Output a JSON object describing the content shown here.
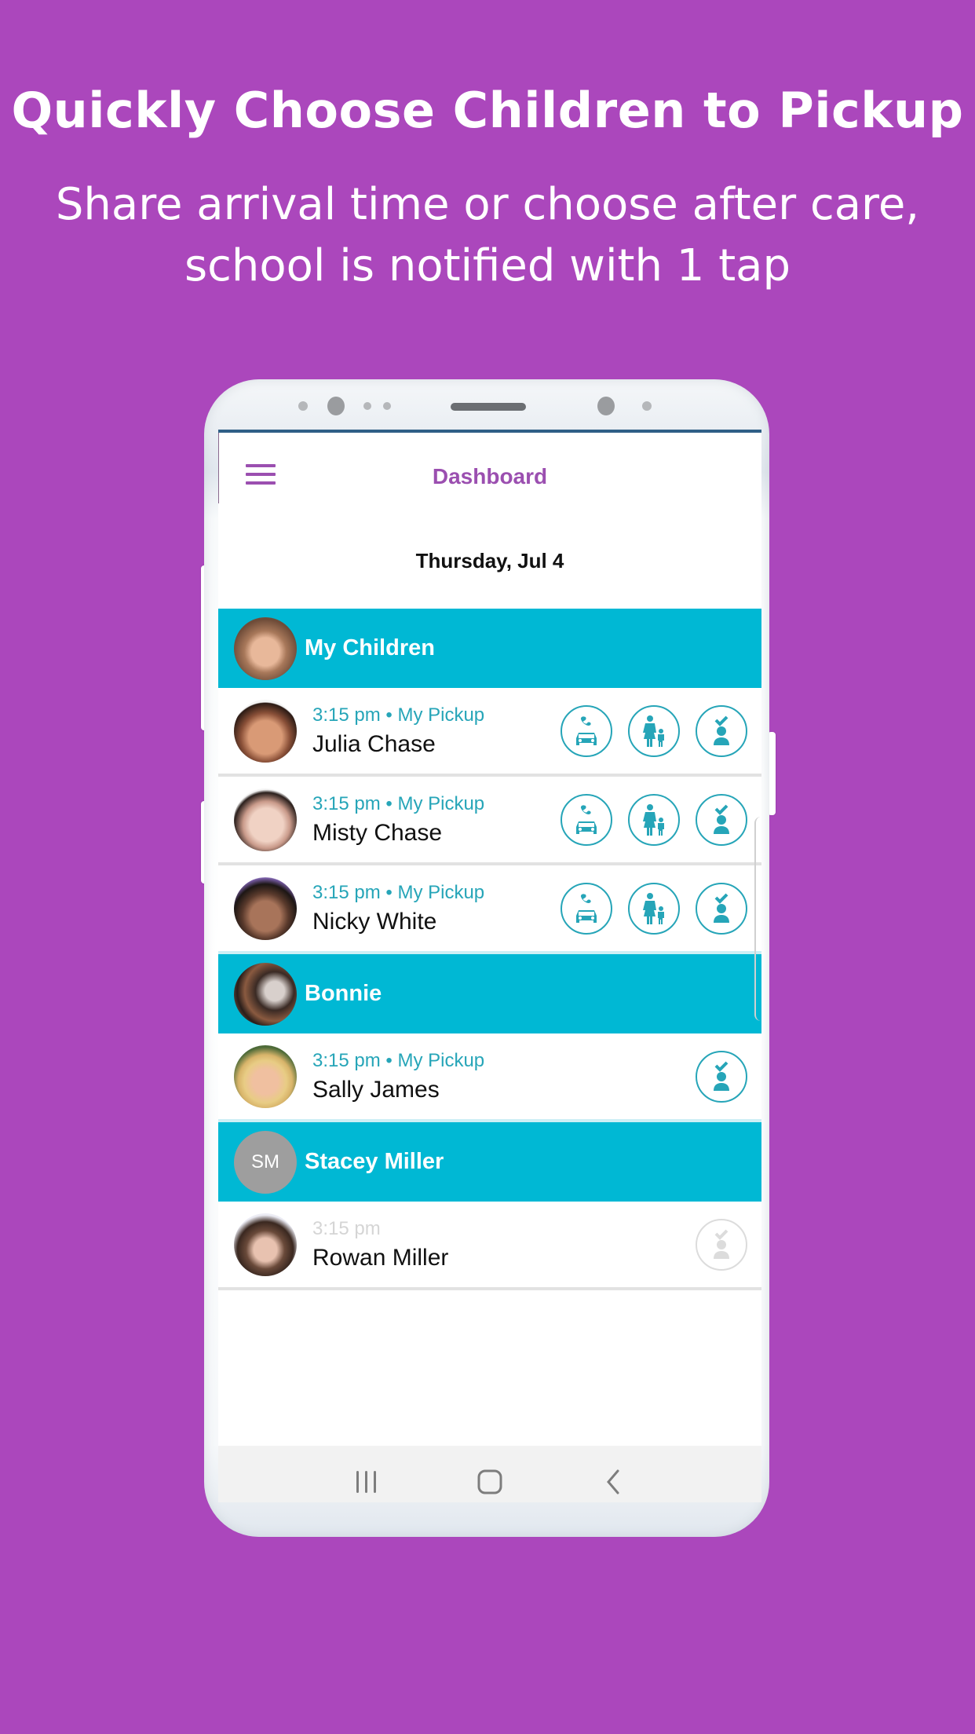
{
  "promo": {
    "headline": "Quickly Choose Children to Pickup",
    "subhead_line1": "Share arrival time or choose after care,",
    "subhead_line2": "school is notified with 1 tap"
  },
  "app": {
    "title": "Dashboard",
    "menu_icon": "hamburger-menu-icon",
    "date": "Thursday, Jul 4"
  },
  "colors": {
    "background": "#ab47bc",
    "accent_purple": "#9b4fb0",
    "group_header": "#00b8d4",
    "status_teal": "#26a5b8"
  },
  "groups": [
    {
      "title": "My Children",
      "avatar": "photo",
      "children": [
        {
          "status": "3:15 pm • My Pickup",
          "name": "Julia Chase",
          "actions": [
            "car-call-icon",
            "parent-child-icon",
            "checkin-person-icon"
          ],
          "enabled": true
        },
        {
          "status": "3:15 pm • My Pickup",
          "name": "Misty Chase",
          "actions": [
            "car-call-icon",
            "parent-child-icon",
            "checkin-person-icon"
          ],
          "enabled": true
        },
        {
          "status": "3:15 pm • My Pickup",
          "name": "Nicky White",
          "actions": [
            "car-call-icon",
            "parent-child-icon",
            "checkin-person-icon"
          ],
          "enabled": true
        }
      ]
    },
    {
      "title": "Bonnie",
      "avatar": "photo",
      "children": [
        {
          "status": "3:15 pm • My Pickup",
          "name": "Sally James",
          "actions": [
            "checkin-person-icon"
          ],
          "enabled": true
        }
      ]
    },
    {
      "title": "Stacey Miller",
      "avatar": "initials",
      "initials": "SM",
      "children": [
        {
          "status": "3:15 pm",
          "name": "Rowan Miller",
          "actions": [
            "checkin-person-icon"
          ],
          "enabled": false
        }
      ]
    }
  ],
  "navbar": {
    "items": [
      "recent-apps-icon",
      "home-icon",
      "back-icon"
    ]
  }
}
